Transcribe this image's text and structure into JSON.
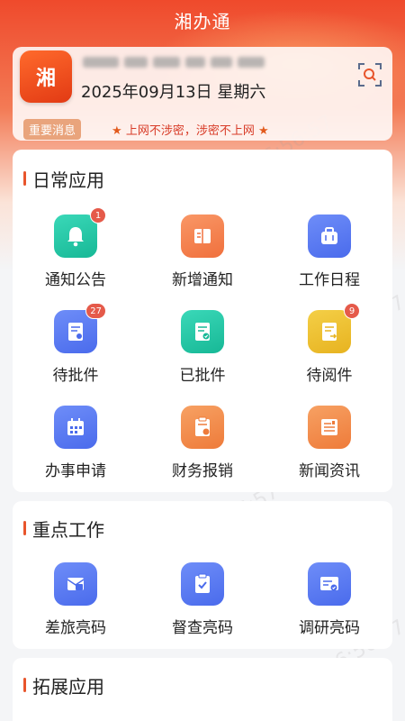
{
  "app": {
    "title": "湘办通"
  },
  "header": {
    "logo_text": "湘",
    "date": "2025年09月13日",
    "weekday": "星期六"
  },
  "notice": {
    "tag": "重要消息",
    "text": "上网不涉密，涉密不上网"
  },
  "daily": {
    "title": "日常应用",
    "items": [
      {
        "label": "通知公告",
        "badge": "1"
      },
      {
        "label": "新增通知",
        "badge": ""
      },
      {
        "label": "工作日程",
        "badge": ""
      },
      {
        "label": "待批件",
        "badge": "27"
      },
      {
        "label": "已批件",
        "badge": ""
      },
      {
        "label": "待阅件",
        "badge": "9"
      },
      {
        "label": "办事申请",
        "badge": ""
      },
      {
        "label": "财务报销",
        "badge": ""
      },
      {
        "label": "新闻资讯",
        "badge": ""
      }
    ]
  },
  "key_work": {
    "title": "重点工作",
    "items": [
      {
        "label": "差旅亮码"
      },
      {
        "label": "督查亮码"
      },
      {
        "label": "调研亮码"
      }
    ]
  },
  "extended": {
    "title": "拓展应用"
  },
  "watermark": "2025-09-13 16:56:57",
  "colors": {
    "accent": "#e8552c",
    "badge": "#e55a4a",
    "notice_text": "#d83c28"
  }
}
